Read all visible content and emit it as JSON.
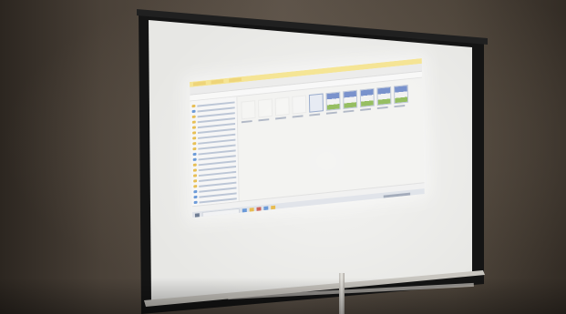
{
  "scene": {
    "description_colors": {
      "wall": "#5d5349",
      "screen": "#ececea",
      "frame": "#151515",
      "stand": "#d8d5cf"
    }
  },
  "projected_ui": {
    "window": "file-explorer",
    "nav_items": [
      {
        "icon": "star-icon"
      },
      {
        "icon": "desktop-icon"
      },
      {
        "icon": "download-icon"
      },
      {
        "icon": "documents-icon"
      },
      {
        "icon": "pictures-icon"
      },
      {
        "icon": "folder-icon"
      },
      {
        "icon": "folder-icon"
      },
      {
        "icon": "folder-icon"
      },
      {
        "icon": "folder-icon"
      },
      {
        "icon": "onedrive-icon"
      },
      {
        "icon": "this-pc-icon"
      },
      {
        "icon": "folder-icon"
      },
      {
        "icon": "folder-icon"
      },
      {
        "icon": "folder-icon"
      },
      {
        "icon": "folder-icon"
      },
      {
        "icon": "folder-icon"
      },
      {
        "icon": "drive-icon"
      },
      {
        "icon": "drive-icon"
      },
      {
        "icon": "network-icon"
      }
    ],
    "files": [
      {
        "kind": "faint"
      },
      {
        "kind": "faint"
      },
      {
        "kind": "faint"
      },
      {
        "kind": "faint"
      },
      {
        "kind": "doc"
      },
      {
        "kind": "thumb"
      },
      {
        "kind": "thumb"
      },
      {
        "kind": "thumb"
      },
      {
        "kind": "thumb"
      },
      {
        "kind": "thumb"
      }
    ],
    "taskbar_apps": [
      "blue",
      "y",
      "r",
      "blue",
      "y"
    ]
  }
}
